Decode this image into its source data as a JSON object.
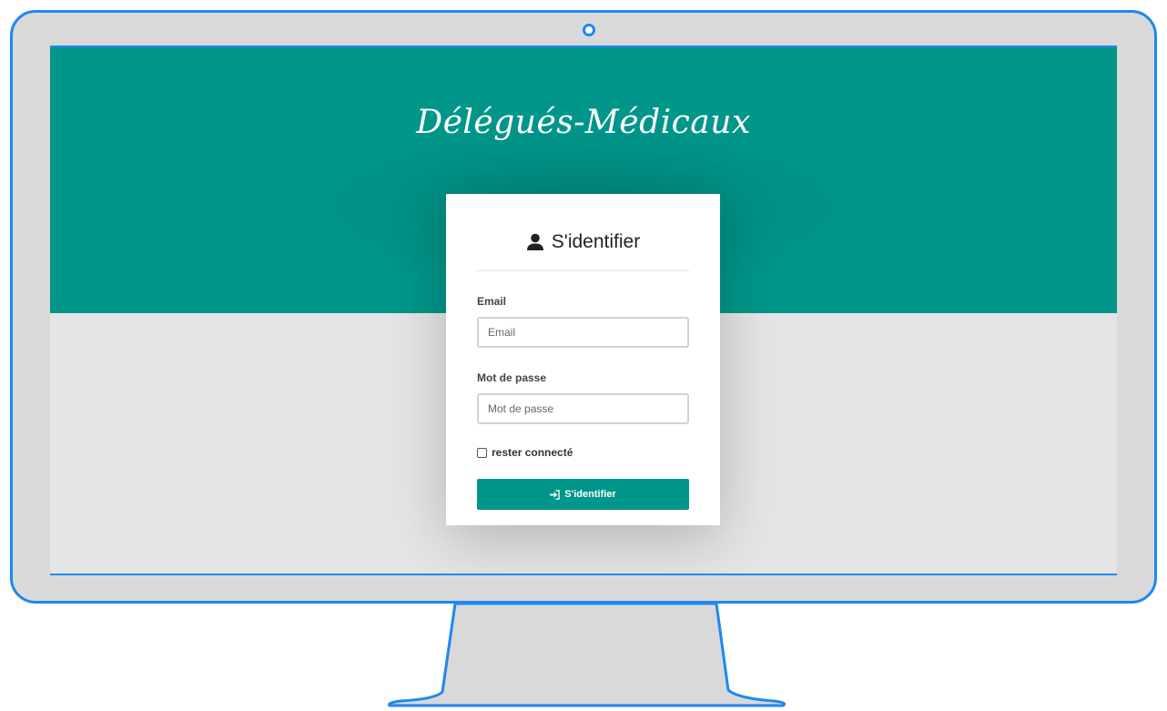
{
  "app": {
    "brand_title": "Délégués-Médicaux"
  },
  "login": {
    "title": "S'identifier",
    "title_icon": "user-icon",
    "email_label": "Email",
    "email_placeholder": "Email",
    "email_value": "",
    "password_label": "Mot de passe",
    "password_placeholder": "Mot de passe",
    "password_value": "",
    "remember_label": "rester connecté",
    "remember_checked": false,
    "submit_label": "S'identifier",
    "submit_icon": "sign-in-icon"
  },
  "colors": {
    "primary": "#01968a",
    "monitor_outline": "#1e88f0",
    "bezel": "#d9d9d9",
    "screen_background": "#e5e5e5"
  }
}
